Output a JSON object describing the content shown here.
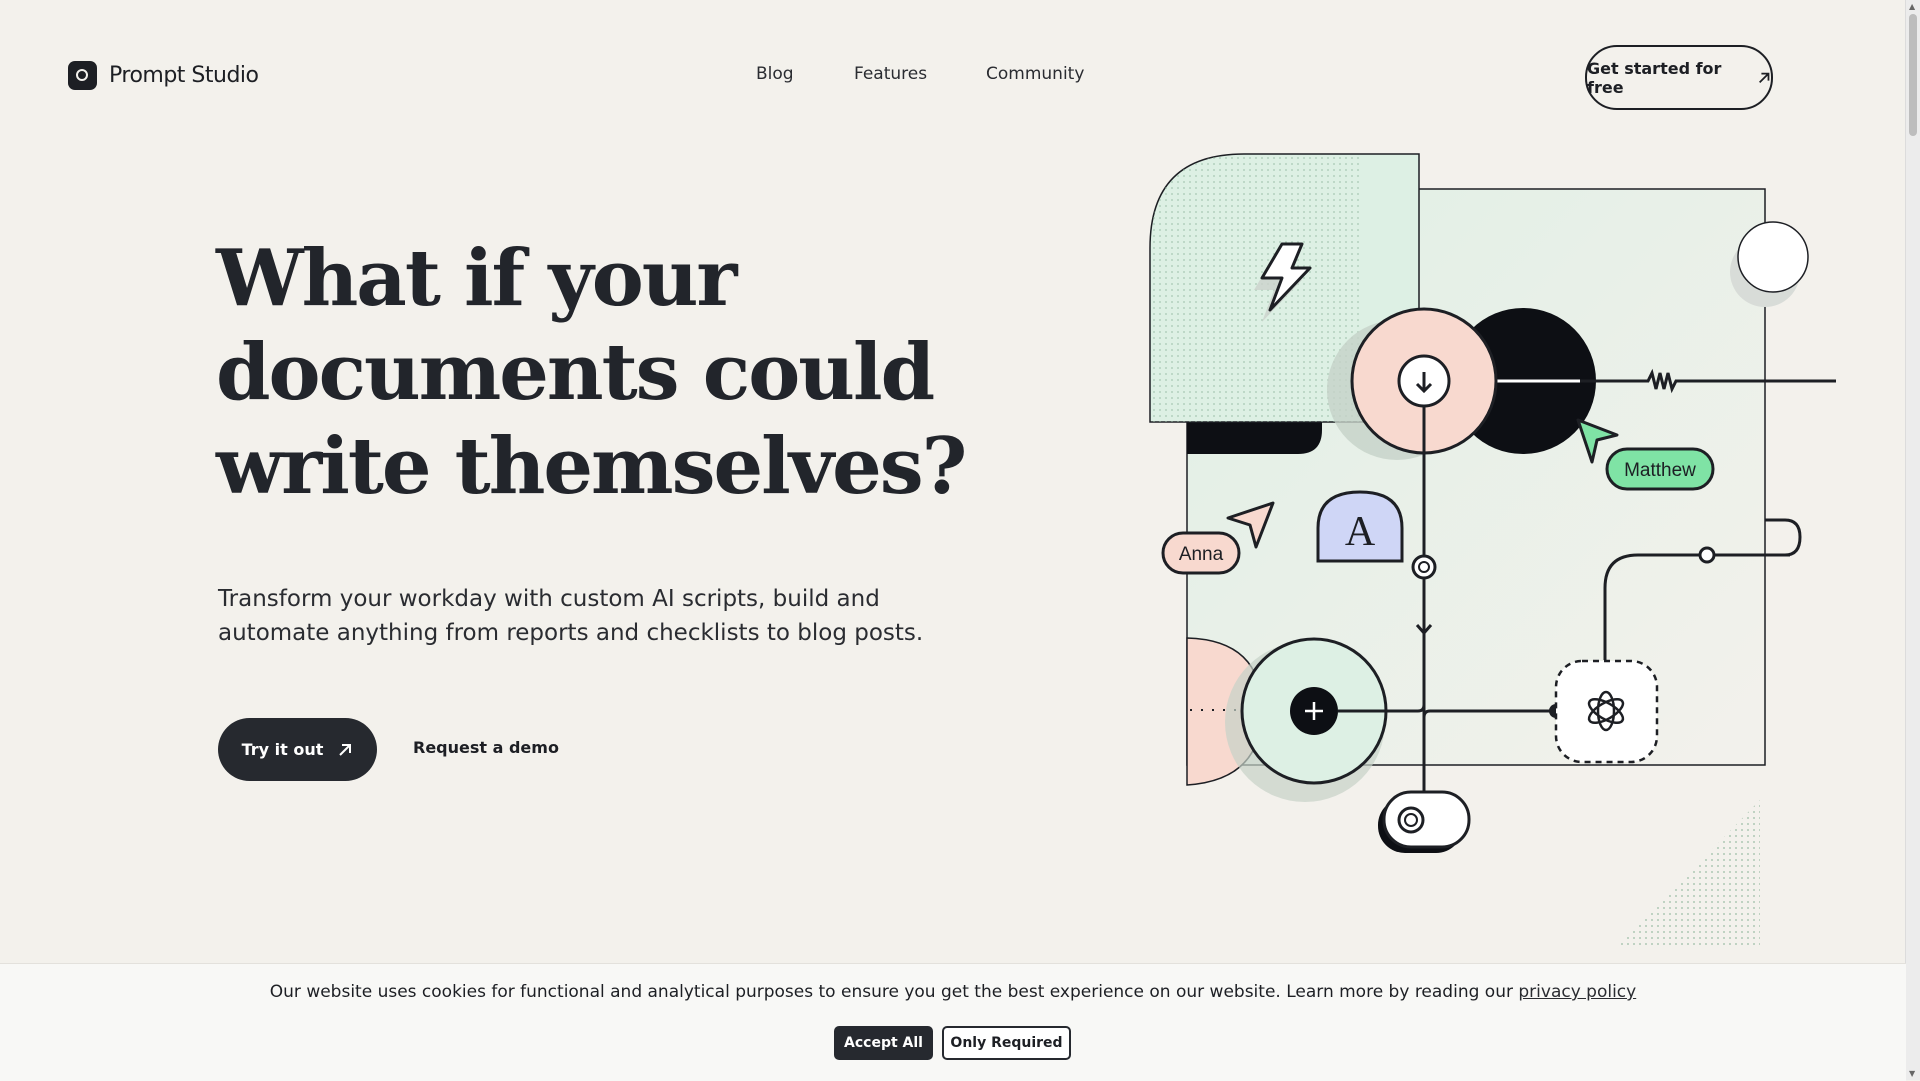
{
  "header": {
    "logo_text": "Prompt Studio",
    "nav": [
      "Blog",
      "Features",
      "Community"
    ],
    "cta_label": "Get started for free"
  },
  "hero": {
    "title_lines": [
      "What if your",
      "documents could",
      "write themselves?"
    ],
    "subtitle_lines": [
      "Transform your workday with custom AI scripts, build and",
      "automate anything from reports and checklists to blog posts."
    ],
    "primary_button": "Try it out",
    "secondary_link": "Request a demo"
  },
  "illustration": {
    "labels": {
      "matthew": "Matthew",
      "anna": "Anna",
      "letter": "A"
    },
    "colors": {
      "mint": "#ddf0e4",
      "peach": "#f8d9cf",
      "lavender": "#cfd6f6",
      "green": "#7fe3a5",
      "dark": "#0d0f14"
    }
  },
  "cookie_banner": {
    "text": "Our website uses cookies for functional and analytical purposes to ensure you get the best experience on our website. Learn more by reading our",
    "link_text": "privacy policy",
    "accept_label": "Accept All",
    "required_label": "Only Required"
  }
}
